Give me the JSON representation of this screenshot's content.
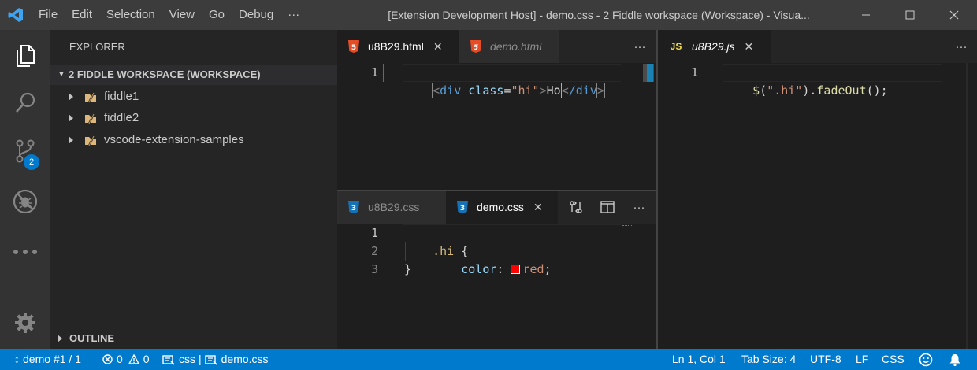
{
  "titlebar": {
    "menu": [
      "File",
      "Edit",
      "Selection",
      "View",
      "Go",
      "Debug",
      "···"
    ],
    "title": "[Extension Development Host] - demo.css - 2 Fiddle workspace (Workspace) - Visua..."
  },
  "activitybar": {
    "icons": [
      "files-icon",
      "search-icon",
      "source-control-icon",
      "debug-icon",
      "more-icon",
      "settings-gear-icon"
    ],
    "scm_badge": "2"
  },
  "sidebar": {
    "title": "EXPLORER",
    "workspace": "2 FIDDLE WORKSPACE (WORKSPACE)",
    "folders": [
      "fiddle1",
      "fiddle2",
      "vscode-extension-samples"
    ],
    "outline": "OUTLINE"
  },
  "editor_html": {
    "tabs": [
      {
        "label": "u8B29.html",
        "icon": "H5",
        "active": true
      },
      {
        "label": "demo.html",
        "icon": "H5",
        "active": false
      }
    ],
    "line_numbers": [
      "1"
    ],
    "code": {
      "lt": "<",
      "tag": "div",
      "attr": " class",
      "eq": "=",
      "val": "\"hi\"",
      "gt": ">",
      "text": "Ho",
      "close_lt": "<",
      "close": "/div",
      "close_gt": ">"
    }
  },
  "editor_css": {
    "tabs": [
      {
        "label": "u8B29.css",
        "icon": "3",
        "active": false
      },
      {
        "label": "demo.css",
        "icon": "3",
        "active": true
      }
    ],
    "line_numbers": [
      "1",
      "2",
      "3"
    ],
    "line1": {
      "selector": ".hi",
      "brace": " {"
    },
    "line2": {
      "prop": "color",
      "colon": ": ",
      "value": "red",
      "semi": ";",
      "swatch": "#ff0000"
    },
    "line3": "}"
  },
  "editor_js": {
    "tabs": [
      {
        "label": "u8B29.js",
        "icon": "JS",
        "active": true
      }
    ],
    "line_numbers": [
      "1"
    ],
    "code": {
      "fn": "$",
      "open": "(",
      "str": "\".hi\"",
      "close": ")",
      "dot": ".",
      "method": "fadeOut",
      "tail": "();"
    }
  },
  "statusbar": {
    "branch": "demo #1 / 1",
    "errors": "0",
    "warnings": "0",
    "lang_path": "css",
    "file": "demo.css",
    "cursor": "Ln 1, Col 1",
    "tab_size": "Tab Size: 4",
    "encoding": "UTF-8",
    "eol": "LF",
    "language": "CSS"
  },
  "colors": {
    "accent": "#007acc",
    "titlebar": "#3c3c3c",
    "activitybar": "#333333",
    "sidebar": "#252526",
    "editor": "#1e1e1e",
    "html_icon": "#e44d26",
    "css_icon": "#1572b6",
    "js_icon": "#f0db4f"
  }
}
